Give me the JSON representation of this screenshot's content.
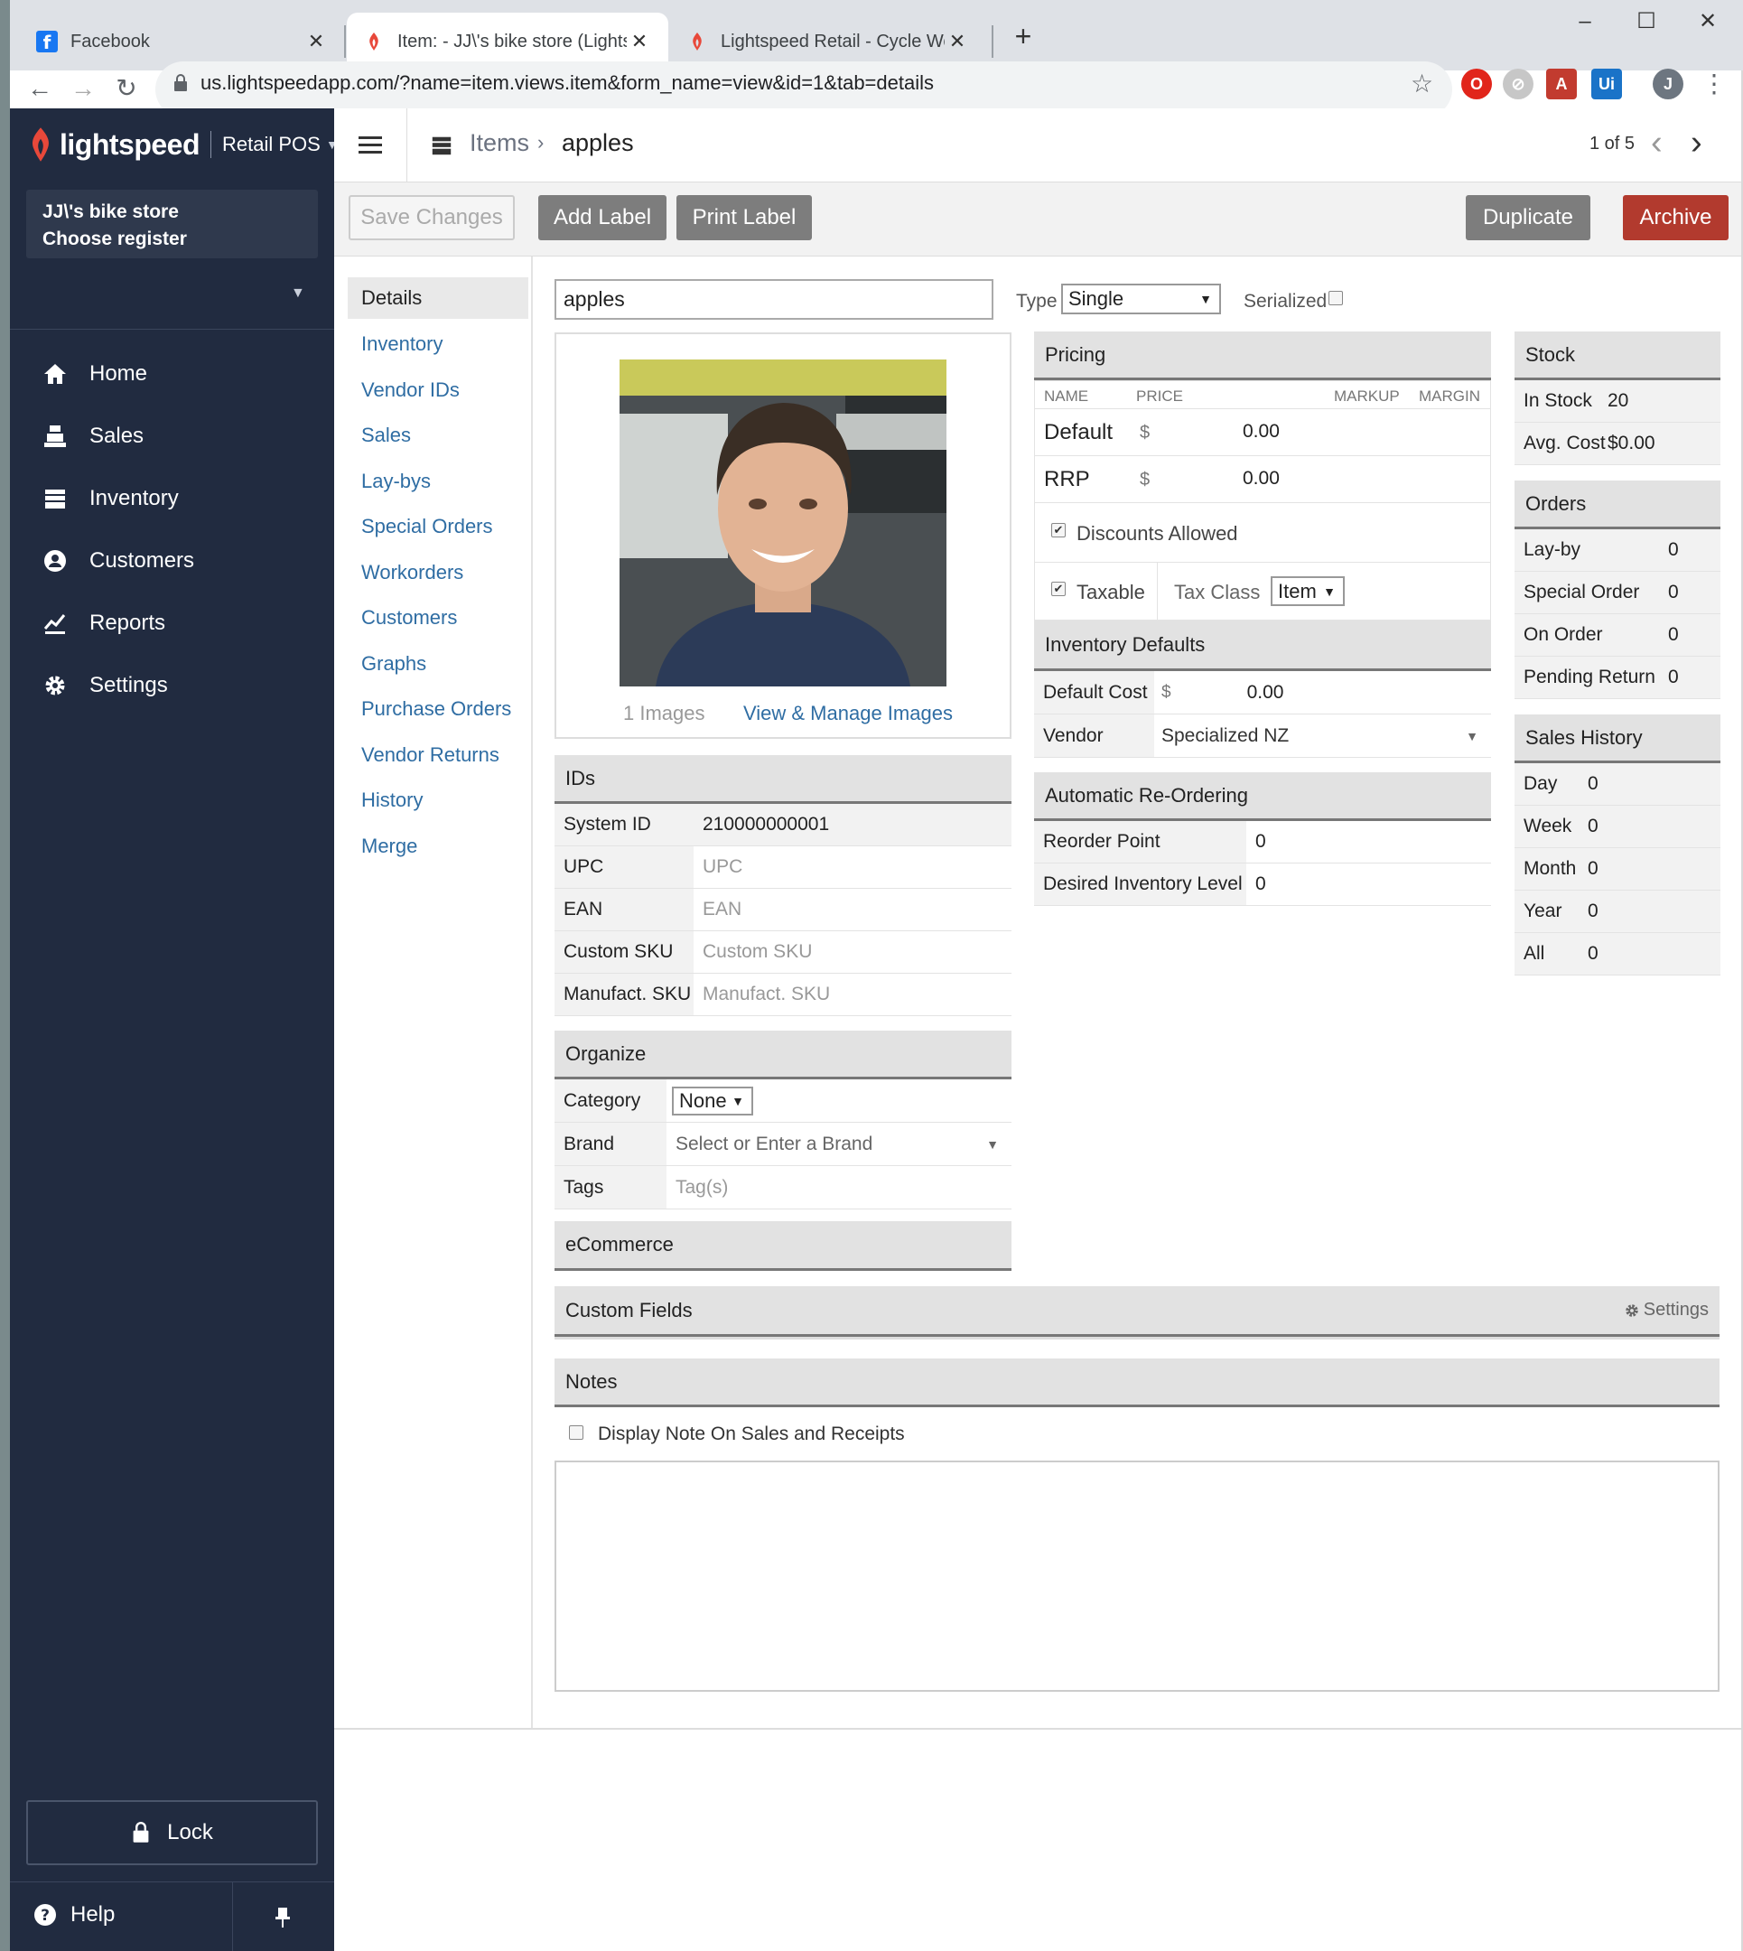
{
  "browser": {
    "tabs": [
      {
        "label": "Facebook"
      },
      {
        "label": "Item: - JJ\\'s bike store (Lightspeed"
      },
      {
        "label": "Lightspeed Retail - Cycle World D"
      }
    ],
    "url": "us.lightspeedapp.com/?name=item.views.item&form_name=view&id=1&tab=details",
    "profile_initial": "J"
  },
  "sidebar": {
    "brand": "lightspeed",
    "product": "Retail POS",
    "store_name": "JJ\\'s bike store",
    "register": "Choose register",
    "nav": [
      {
        "label": "Home",
        "icon": "home-icon"
      },
      {
        "label": "Sales",
        "icon": "register-icon"
      },
      {
        "label": "Inventory",
        "icon": "inventory-icon"
      },
      {
        "label": "Customers",
        "icon": "customer-icon"
      },
      {
        "label": "Reports",
        "icon": "chart-icon"
      },
      {
        "label": "Settings",
        "icon": "gear-icon"
      }
    ],
    "lock": "Lock",
    "help": "Help"
  },
  "topbar": {
    "breadcrumb_parent": "Items",
    "breadcrumb_current": "apples",
    "pager": "1 of 5"
  },
  "actions": {
    "save": "Save Changes",
    "add_label": "Add Label",
    "print_label": "Print Label",
    "duplicate": "Duplicate",
    "archive": "Archive"
  },
  "subnav": [
    "Details",
    "Inventory",
    "Vendor IDs",
    "Sales",
    "Lay-bys",
    "Special Orders",
    "Workorders",
    "Customers",
    "Graphs",
    "Purchase Orders",
    "Vendor Returns",
    "History",
    "Merge"
  ],
  "item": {
    "name": "apples",
    "type_label": "Type",
    "type_value": "Single",
    "serialized_label": "Serialized",
    "images_count": "1 Images",
    "manage_images": "View & Manage Images"
  },
  "ids": {
    "title": "IDs",
    "rows": [
      {
        "label": "System ID",
        "value": "210000000001",
        "placeholder": ""
      },
      {
        "label": "UPC",
        "value": "",
        "placeholder": "UPC"
      },
      {
        "label": "EAN",
        "value": "",
        "placeholder": "EAN"
      },
      {
        "label": "Custom SKU",
        "value": "",
        "placeholder": "Custom SKU"
      },
      {
        "label": "Manufact. SKU",
        "value": "",
        "placeholder": "Manufact. SKU"
      }
    ]
  },
  "organize": {
    "title": "Organize",
    "category_label": "Category",
    "category_value": "None",
    "brand_label": "Brand",
    "brand_placeholder": "Select or Enter a Brand",
    "tags_label": "Tags",
    "tags_placeholder": "Tag(s)"
  },
  "ecommerce": {
    "title": "eCommerce"
  },
  "pricing": {
    "title": "Pricing",
    "headers": {
      "name": "NAME",
      "price": "PRICE",
      "markup": "MARKUP",
      "margin": "MARGIN"
    },
    "rows": [
      {
        "name": "Default",
        "currency": "$",
        "price": "0.00"
      },
      {
        "name": "RRP",
        "currency": "$",
        "price": "0.00"
      }
    ],
    "discounts_label": "Discounts Allowed",
    "taxable_label": "Taxable",
    "tax_class_label": "Tax Class",
    "tax_class_value": "Item"
  },
  "inventory_defaults": {
    "title": "Inventory Defaults",
    "default_cost_label": "Default Cost",
    "default_cost_currency": "$",
    "default_cost_value": "0.00",
    "vendor_label": "Vendor",
    "vendor_value": "Specialized NZ"
  },
  "reordering": {
    "title": "Automatic Re-Ordering",
    "reorder_point_label": "Reorder Point",
    "reorder_point_value": "0",
    "desired_label": "Desired Inventory Level",
    "desired_value": "0"
  },
  "stock": {
    "title": "Stock",
    "rows": [
      {
        "label": "In Stock",
        "value": "20"
      },
      {
        "label": "Avg. Cost",
        "value": "$0.00"
      }
    ]
  },
  "orders": {
    "title": "Orders",
    "rows": [
      {
        "label": "Lay-by",
        "value": "0"
      },
      {
        "label": "Special Order",
        "value": "0"
      },
      {
        "label": "On Order",
        "value": "0"
      },
      {
        "label": "Pending Return",
        "value": "0"
      }
    ]
  },
  "sales_history": {
    "title": "Sales History",
    "rows": [
      {
        "label": "Day",
        "value": "0"
      },
      {
        "label": "Week",
        "value": "0"
      },
      {
        "label": "Month",
        "value": "0"
      },
      {
        "label": "Year",
        "value": "0"
      },
      {
        "label": "All",
        "value": "0"
      }
    ]
  },
  "custom_fields": {
    "title": "Custom Fields",
    "settings": "Settings"
  },
  "notes": {
    "title": "Notes",
    "display_note_label": "Display Note On Sales and Receipts"
  },
  "colors": {
    "sidebar": "#212b40",
    "archive": "#b23a2e",
    "link": "#2f6da3",
    "brand_red": "#e8483a"
  }
}
